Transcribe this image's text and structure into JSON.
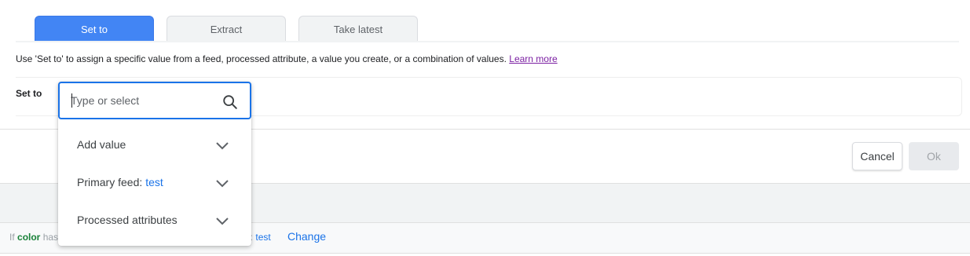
{
  "tabs": [
    {
      "label": "Set to",
      "active": true
    },
    {
      "label": "Extract",
      "active": false
    },
    {
      "label": "Take latest",
      "active": false
    }
  ],
  "description": {
    "text": "Use 'Set to' to assign a specific value from a feed, processed attribute, a value you create, or a combination of values.",
    "link": "Learn more"
  },
  "set_to": {
    "label": "Set to"
  },
  "search": {
    "placeholder": "Type or select",
    "value": ""
  },
  "dropdown": {
    "items": [
      {
        "label": "Add value",
        "suffix": ""
      },
      {
        "label": "Primary feed:",
        "suffix": "test"
      },
      {
        "label": "Processed attributes",
        "suffix": ""
      }
    ]
  },
  "actions": {
    "cancel": "Cancel",
    "ok": "Ok"
  },
  "condition": {
    "prefix": "If",
    "attribute": "color",
    "verb": "has",
    "tail": "n:",
    "value": "test",
    "change": "Change"
  },
  "colors": {
    "accent": "#4285f4",
    "link_blue": "#1a73e8",
    "learn_more": "#7b1fa2",
    "green": "#188038"
  }
}
